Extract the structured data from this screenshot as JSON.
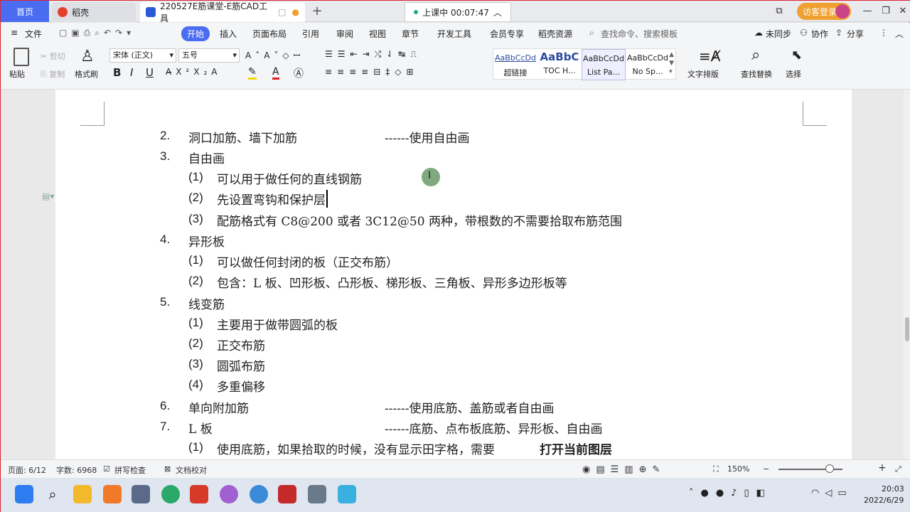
{
  "titlebar": {
    "tabs": [
      {
        "label": "首页"
      },
      {
        "label": "稻壳"
      },
      {
        "label": "220527E筋课堂-E筋CAD工具"
      }
    ],
    "timer": "上课中 00:07:47",
    "login": "访客登录"
  },
  "menu": {
    "items": [
      "文件",
      "开始",
      "插入",
      "页面布局",
      "引用",
      "审阅",
      "视图",
      "章节",
      "开发工具",
      "会员专享",
      "稻壳资源"
    ],
    "search_placeholder": "查找命令、搜索模板",
    "right": [
      "未同步",
      "协作",
      "分享"
    ]
  },
  "ribbon": {
    "paste": "粘贴",
    "cut": "剪切",
    "copy": "复制",
    "format_painter": "格式刷",
    "font": "宋体 (正文)",
    "size": "五号",
    "styles": [
      {
        "sample": "AaBbCcDd",
        "name": "超链接"
      },
      {
        "sample": "AaBbC",
        "name": "TOC H..."
      },
      {
        "sample": "AaBbCcDd",
        "name": "List Pa..."
      },
      {
        "sample": "AaBbCcDd",
        "name": "No Sp..."
      }
    ],
    "text_layout": "文字排版",
    "find_replace": "查找替换",
    "select": "选择"
  },
  "doc": {
    "lines": [
      {
        "num": "2.",
        "text": "洞口加筋、墙下加筋",
        "tail": "------使用自由画"
      },
      {
        "num": "3.",
        "text": "自由画",
        "tail": ""
      },
      {
        "num": "(1)",
        "text": "可以用于做任何的直线钢筋",
        "tail": ""
      },
      {
        "num": "(2)",
        "text": "先设置弯钩和保护层",
        "tail": ""
      },
      {
        "num": "(3)",
        "text": "配筋格式有 C8@200 或者 3C12@50 两种，带根数的不需要拾取布筋范围",
        "tail": ""
      },
      {
        "num": "4.",
        "text": "异形板",
        "tail": ""
      },
      {
        "num": "(1)",
        "text": "可以做任何封闭的板（正交布筋）",
        "tail": ""
      },
      {
        "num": "(2)",
        "text": "包含：L 板、凹形板、凸形板、梯形板、三角板、异形多边形板等",
        "tail": ""
      },
      {
        "num": "5.",
        "text": "线变筋",
        "tail": ""
      },
      {
        "num": "(1)",
        "text": "主要用于做带圆弧的板",
        "tail": ""
      },
      {
        "num": "(2)",
        "text": "正交布筋",
        "tail": ""
      },
      {
        "num": "(3)",
        "text": "圆弧布筋",
        "tail": ""
      },
      {
        "num": "(4)",
        "text": "多重偏移",
        "tail": ""
      },
      {
        "num": "6.",
        "text": "单向附加筋",
        "tail": "------使用底筋、盖筋或者自由画"
      },
      {
        "num": "7.",
        "text": "L 板",
        "tail": "------底筋、点布板底筋、异形板、自由画"
      },
      {
        "num": "(1)",
        "text": "使用底筋，如果拾取的时候，没有显示田字格，需要",
        "tail": "打开当前图层"
      }
    ]
  },
  "status": {
    "page": "页面: 6/12",
    "words": "字数: 6968",
    "spell": "拼写检查",
    "proof": "文档校对",
    "zoom": "150%"
  },
  "taskbar": {
    "time": "20:03",
    "date": "2022/6/29"
  }
}
